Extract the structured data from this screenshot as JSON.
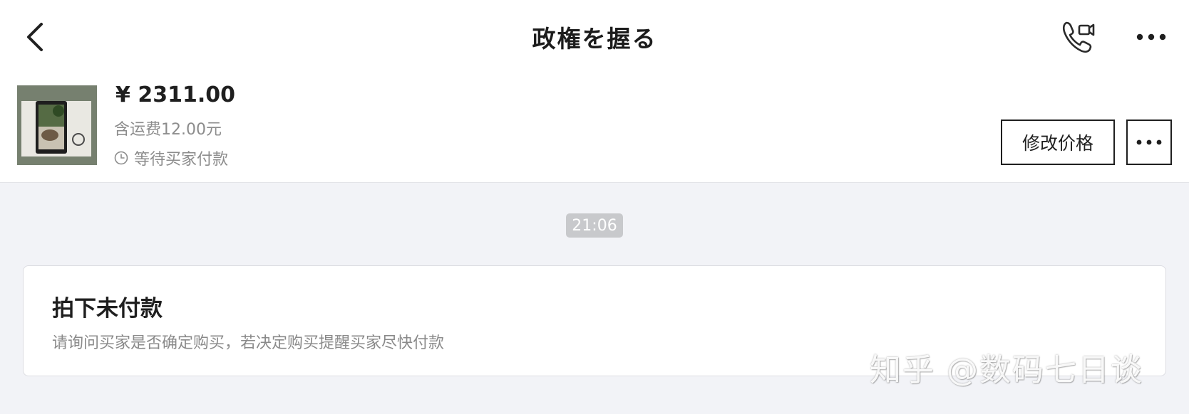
{
  "header": {
    "title": "政権を握る",
    "back_icon": "chevron-left-icon",
    "call_icon": "phone-video-icon",
    "more_icon": "more-horizontal-icon"
  },
  "order": {
    "price": "¥ 2311.00",
    "shipping": "含运费12.00元",
    "status": "等待买家付款",
    "status_icon": "clock-icon",
    "modify_price_label": "修改价格",
    "more_icon": "more-horizontal-icon"
  },
  "chat": {
    "timestamp": "21:06",
    "message": {
      "title": "拍下未付款",
      "body": "请询问买家是否确定购买，若决定购买提醒买家尽快付款"
    }
  },
  "watermark": "知乎 @数码七日谈",
  "colors": {
    "page_background": "#f2f3f7",
    "surface": "#ffffff",
    "text_primary": "#1f1f1f",
    "text_secondary": "#8c8c8c",
    "timestamp_badge": "#c8c9cc"
  }
}
